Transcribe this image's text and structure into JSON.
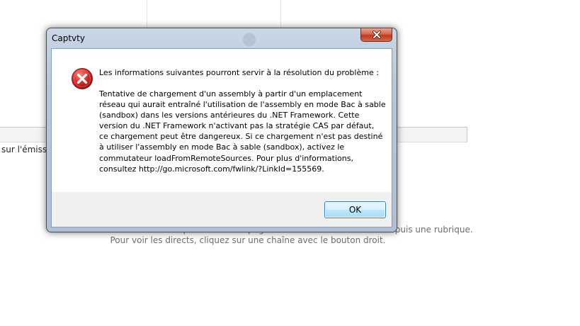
{
  "background": {
    "partial_tab_label": "sur l'émissio",
    "hint_line_1": "Découvrez les émissions disponibles sur la page en sélectionnant une chaîne puis une rubrique.",
    "hint_line_2": "Pour voir les directs, cliquez sur une chaîne avec le bouton droit."
  },
  "dialog": {
    "title": "Captvty",
    "icon": "error-icon",
    "heading": "Les informations suivantes pourront servir à la résolution du problème :",
    "body_lines": [
      "Tentative de chargement d'un assembly à partir d'un emplacement",
      "réseau qui aurait entraîné l'utilisation de l'assembly en mode Bac à sable",
      "(sandbox) dans les versions antérieures du .NET Framework. Cette",
      "version du .NET Framework n'activant pas la stratégie CAS par défaut,",
      "ce chargement peut être dangereux. Si ce chargement n'est pas destiné",
      "à utiliser l'assembly en mode Bac à sable (sandbox), activez le",
      "commutateur loadFromRemoteSources. Pour plus d'informations,",
      "consultez http://go.microsoft.com/fwlink/?LinkId=155569."
    ],
    "ok_label": "OK",
    "close_icon": "close-icon"
  },
  "colors": {
    "error_red": "#d62d2d",
    "close_button_red": "#c0391f",
    "ok_button_border": "#3c7fb1"
  }
}
